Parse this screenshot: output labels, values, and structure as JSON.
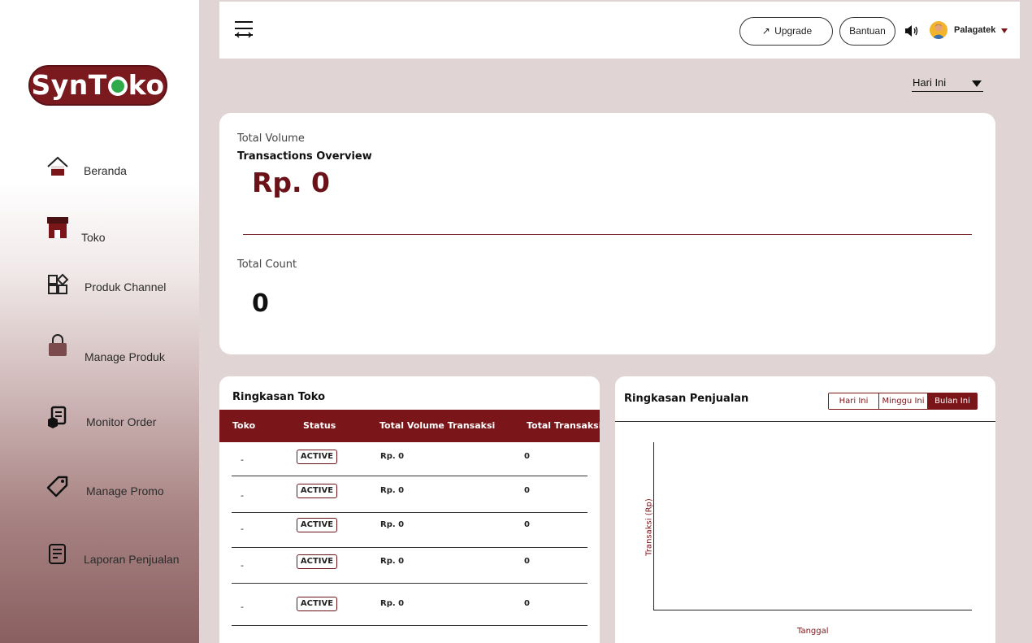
{
  "brand": {
    "logo_text_left": "SynT",
    "logo_text_right": "ko"
  },
  "sidebar": {
    "items": [
      {
        "label": "Beranda",
        "icon": "home-icon"
      },
      {
        "label": "Toko",
        "icon": "store-icon"
      },
      {
        "label": "Produk Channel",
        "icon": "channel-icon"
      },
      {
        "label": "Manage Produk",
        "icon": "bag-icon"
      },
      {
        "label": "Monitor Order",
        "icon": "order-icon"
      },
      {
        "label": "Manage Promo",
        "icon": "tag-icon"
      },
      {
        "label": "Laporan Penjualan",
        "icon": "report-icon"
      }
    ]
  },
  "topbar": {
    "upgrade_label": "Upgrade",
    "bantuan_label": "Bantuan",
    "username": "Palagatek"
  },
  "period": {
    "selected": "Hari Ini"
  },
  "overview": {
    "total_volume_label": "Total Volume",
    "transactions_label": "Transactions Overview",
    "amount": "Rp. 0",
    "total_count_label": "Total Count",
    "count": "0"
  },
  "toko_summary": {
    "title": "Ringkasan Toko",
    "columns": [
      "Toko",
      "Status",
      "Total Volume Transaksi",
      "Total Transaksi"
    ],
    "rows": [
      {
        "toko": "-",
        "status": "ACTIVE",
        "volume": "Rp. 0",
        "total": "0"
      },
      {
        "toko": "-",
        "status": "ACTIVE",
        "volume": "Rp. 0",
        "total": "0"
      },
      {
        "toko": "-",
        "status": "ACTIVE",
        "volume": "Rp. 0",
        "total": "0"
      },
      {
        "toko": "-",
        "status": "ACTIVE",
        "volume": "Rp. 0",
        "total": "0"
      },
      {
        "toko": "-",
        "status": "ACTIVE",
        "volume": "Rp. 0",
        "total": "0"
      }
    ]
  },
  "sales_summary": {
    "title": "Ringkasan Penjualan",
    "tabs": [
      "Hari Ini",
      "Minggu Ini",
      "Bulan Ini"
    ],
    "active_tab": "Bulan Ini",
    "ylabel": "Transaksi (Rp)",
    "xlabel": "Tanggal"
  },
  "colors": {
    "accent": "#7a1519",
    "background": "#e0d5d4"
  }
}
